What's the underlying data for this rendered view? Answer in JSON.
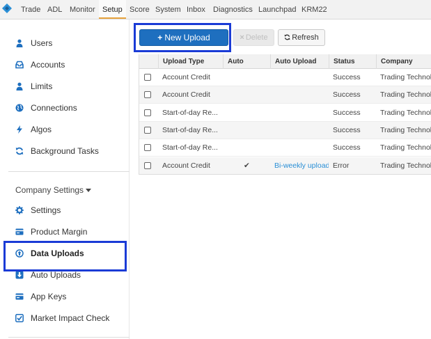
{
  "nav": {
    "items": [
      "Trade",
      "ADL",
      "Monitor",
      "Setup",
      "Score",
      "System",
      "Inbox",
      "Diagnostics",
      "Launchpad",
      "KRM22"
    ],
    "active": "Setup",
    "accent_color": "#e8a33c"
  },
  "sidebar": {
    "items": [
      {
        "label": "Users",
        "icon": "user-icon"
      },
      {
        "label": "Accounts",
        "icon": "inbox-icon"
      },
      {
        "label": "Limits",
        "icon": "user-icon"
      },
      {
        "label": "Connections",
        "icon": "globe-icon"
      },
      {
        "label": "Algos",
        "icon": "bolt-icon"
      },
      {
        "label": "Background Tasks",
        "icon": "refresh-icon"
      }
    ],
    "section_title": "Company Settings",
    "section_items": [
      {
        "label": "Settings",
        "icon": "gear-icon"
      },
      {
        "label": "Product Margin",
        "icon": "card-icon"
      },
      {
        "label": "Data Uploads",
        "icon": "upload-circle-icon"
      },
      {
        "label": "Auto Uploads",
        "icon": "download-icon"
      },
      {
        "label": "App Keys",
        "icon": "card-icon"
      },
      {
        "label": "Market Impact Check",
        "icon": "checkbox-icon"
      }
    ],
    "active": "Data Uploads"
  },
  "toolbar": {
    "new_upload": "New Upload",
    "delete": "Delete",
    "refresh": "Refresh",
    "primary_color": "#1e6fbf"
  },
  "table": {
    "columns": [
      "Upload Type",
      "Auto",
      "Auto Upload",
      "Status",
      "Company"
    ],
    "rows": [
      {
        "type": "Account Credit",
        "auto": false,
        "auto_upload": "",
        "status": "Success",
        "company": "Trading Technologies"
      },
      {
        "type": "Account Credit",
        "auto": false,
        "auto_upload": "",
        "status": "Success",
        "company": "Trading Technologies"
      },
      {
        "type": "Start-of-day Re...",
        "auto": false,
        "auto_upload": "",
        "status": "Success",
        "company": "Trading Technologies"
      },
      {
        "type": "Start-of-day Re...",
        "auto": false,
        "auto_upload": "",
        "status": "Success",
        "company": "Trading Technologies"
      },
      {
        "type": "Start-of-day Re...",
        "auto": false,
        "auto_upload": "",
        "status": "Success",
        "company": "Trading Technologies"
      },
      {
        "type": "Account Credit",
        "auto": true,
        "auto_upload": "Bi-weekly upload",
        "status": "Error",
        "company": "Trading Technologies"
      }
    ]
  },
  "highlight_color": "#1a3bd6"
}
